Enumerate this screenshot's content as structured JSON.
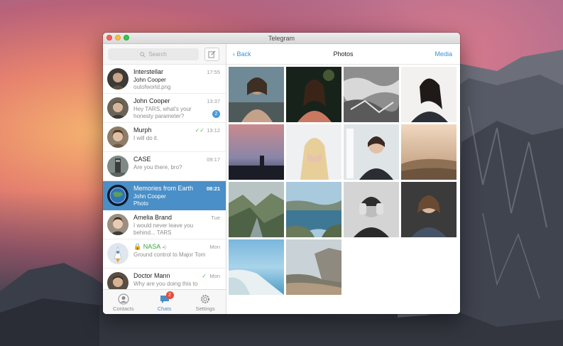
{
  "window": {
    "title": "Telegram"
  },
  "sidebar": {
    "search_placeholder": "Search",
    "chats": [
      {
        "name": "Interstellar",
        "line1": "John Cooper",
        "line2": "outofworld.png",
        "time": "17:55"
      },
      {
        "name": "John Cooper",
        "line1": "Hey TARS, what's your",
        "line2": "honesty parameter?",
        "time": "13:37",
        "unread": "2"
      },
      {
        "name": "Murph",
        "line1": "I will do it.",
        "time": "13:12"
      },
      {
        "name": "CASE",
        "line1": "Are you there, bro?",
        "time": "09:17"
      },
      {
        "name": "Memories from Earth",
        "line1": "John Cooper",
        "line2": "Photo",
        "time": "08:21"
      },
      {
        "name": "Amelia Brand",
        "line1": "I would never leave you",
        "line2": "behind... TARS",
        "time": "Tue"
      },
      {
        "name": "NASA",
        "line1": "Ground control to Major Tom",
        "time": "Mon"
      },
      {
        "name": "Doctor Mann",
        "line1": "Why are you doing this to",
        "time": "Mon"
      }
    ],
    "tabs": [
      {
        "label": "Contacts"
      },
      {
        "label": "Chats",
        "badge": "2"
      },
      {
        "label": "Settings"
      }
    ]
  },
  "main": {
    "back_label": "Back",
    "title": "Photos",
    "media_label": "Media"
  },
  "colors": {
    "accent": "#4a8fc7",
    "badge": "#e74c3c",
    "link": "#3d8fd0"
  }
}
